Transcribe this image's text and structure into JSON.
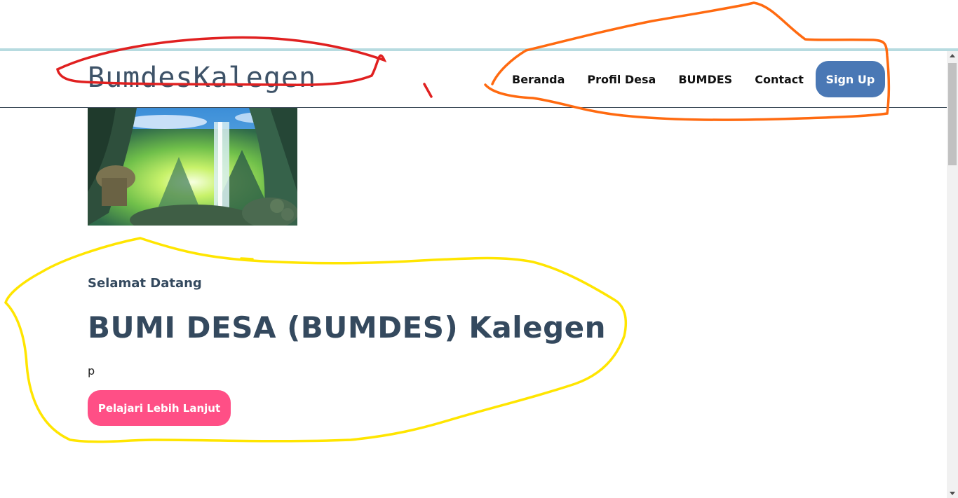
{
  "navbar": {
    "brand": "BumdesKalegen",
    "links": [
      {
        "label": "Beranda"
      },
      {
        "label": "Profil Desa"
      },
      {
        "label": "BUMDES"
      },
      {
        "label": "Contact"
      }
    ],
    "signup_label": "Sign Up"
  },
  "hero": {
    "image_icon": "landscape-illustration",
    "welcome": "Selamat Datang",
    "headline": "BUMI DESA (BUMDES) Kalegen",
    "paragraph": "p",
    "cta_label": "Pelajari Lebih Lanjut"
  },
  "colors": {
    "accent_strip": "#b7dbe0",
    "brand_text": "#3e5368",
    "signup_button": "#4a78b5",
    "cta_button": "#ff4f86",
    "heading_text": "#34495e",
    "annotation_red": "#e02020",
    "annotation_orange": "#ff6a10",
    "annotation_yellow": "#ffe500"
  }
}
